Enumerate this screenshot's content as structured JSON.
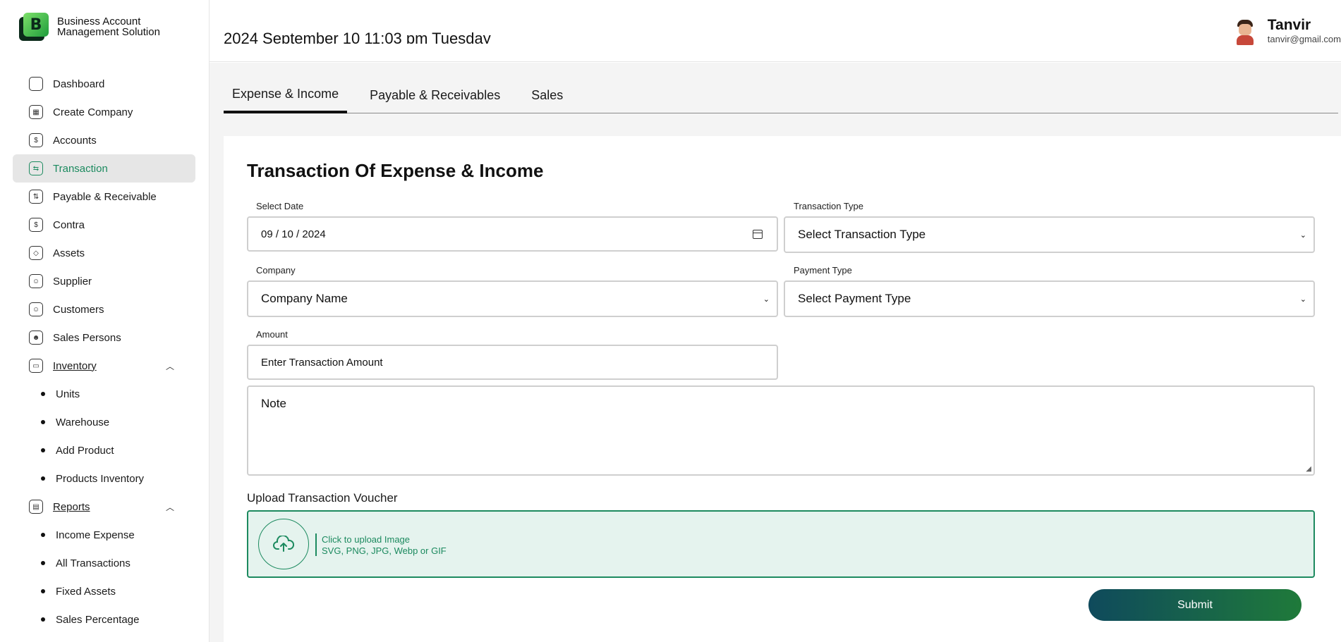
{
  "app": {
    "name": "Business Account Management Solution",
    "logo_letter": "B"
  },
  "sidebar": {
    "items": [
      {
        "label": "Dashboard",
        "icon": "home-icon"
      },
      {
        "label": "Create Company",
        "icon": "building-icon"
      },
      {
        "label": "Accounts",
        "icon": "money-bag-icon"
      },
      {
        "label": "Transaction",
        "icon": "transfer-icon",
        "active": true
      },
      {
        "label": "Payable & Receivable",
        "icon": "exchange-icon"
      },
      {
        "label": "Contra",
        "icon": "dollar-icon"
      },
      {
        "label": "Assets",
        "icon": "box-icon"
      },
      {
        "label": "Supplier",
        "icon": "contact-icon"
      },
      {
        "label": "Customers",
        "icon": "contact-icon"
      },
      {
        "label": "Sales Persons",
        "icon": "person-icon"
      }
    ],
    "inventory": {
      "label": "Inventory",
      "sub": [
        "Units",
        "Warehouse",
        "Add Product",
        "Products Inventory"
      ]
    },
    "reports": {
      "label": "Reports",
      "sub": [
        "Income Expense",
        "All Transactions",
        "Fixed Assets",
        "Sales Percentage"
      ]
    }
  },
  "header": {
    "datetime": "2024 September 10 11:03 pm Tuesday",
    "user_name": "Tanvir",
    "user_email": "tanvir@gmail.com"
  },
  "tabs": [
    "Expense & Income",
    "Payable & Receivables",
    "Sales"
  ],
  "form": {
    "title": "Transaction Of Expense & Income",
    "date_label": "Select Date",
    "date_value": "09 / 10 / 2024",
    "transaction_type_label": "Transaction Type",
    "transaction_type_value": "Select Transaction Type",
    "company_label": "Company",
    "company_value": "Company Name",
    "payment_type_label": "Payment Type",
    "payment_type_value": "Select Payment Type",
    "amount_label": "Amount",
    "amount_placeholder": "Enter Transaction Amount",
    "note_placeholder": "Note",
    "upload_label": "Upload Transaction Voucher",
    "upload_text": "Click to upload Image",
    "upload_formats": "SVG, PNG, JPG, Webp or GIF",
    "submit_label": "Submit"
  },
  "colors": {
    "accent": "#1c8a5f",
    "upload_bg": "#e5f3ee",
    "submit_gradient_start": "#0f4a5c",
    "submit_gradient_end": "#1f7a3a"
  }
}
